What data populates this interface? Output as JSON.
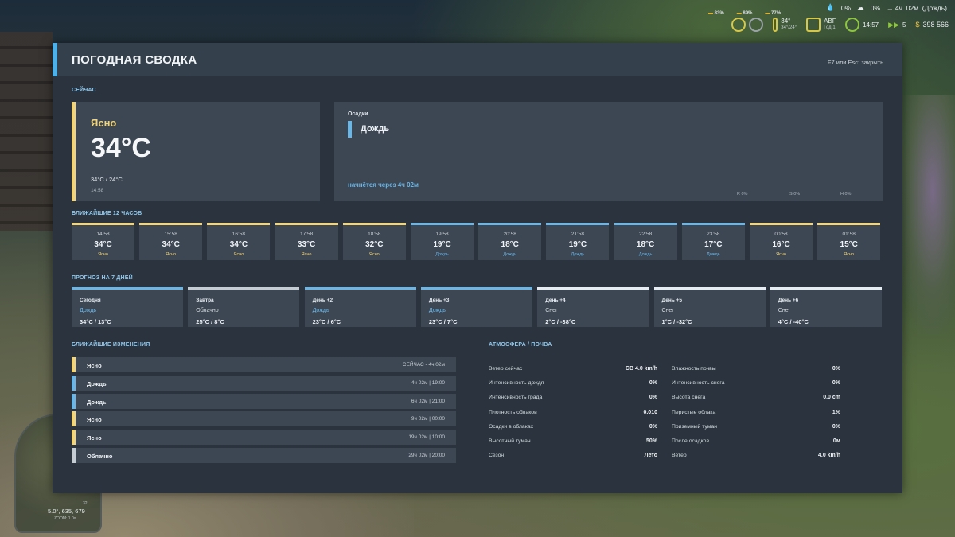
{
  "hud": {
    "stat1": "0%",
    "stat2": "0%",
    "forecast": "→ 4ч. 02м. (Дождь)",
    "mini1": "83%",
    "mini2": "89%",
    "mini3": "77%",
    "temp": "34°",
    "temp_range": "34°/24°",
    "month": "АВГ",
    "year": "Год 1",
    "clock": "14:57",
    "speed": "5",
    "money_symbol": "$",
    "money": "398 566"
  },
  "minimap": {
    "coords": "5.0°, 635, 679",
    "zoom": "ZOOM: 1.0x",
    "north": "32"
  },
  "panel": {
    "title": "ПОГОДНАЯ СВОДКА",
    "hint": "F7 или Esc: закрыть"
  },
  "sections": {
    "now": "СЕЙЧАС",
    "hours": "БЛИЖАЙШИЕ 12 ЧАСОВ",
    "days": "ПРОГНОЗ НА 7 ДНЕЙ",
    "changes": "БЛИЖАЙШИЕ ИЗМЕНЕНИЯ",
    "atmosphere": "АТМОСФЕРА / ПОЧВА"
  },
  "now": {
    "condition": "Ясно",
    "temp": "34°C",
    "range": "34°C  /  24°C",
    "time": "14:58"
  },
  "precip": {
    "label": "Осадки",
    "value": "Дождь",
    "starts": "начнётся через  4ч 02м",
    "r": "R 0%",
    "s": "S 0%",
    "h": "H 0%"
  },
  "hours": [
    {
      "time": "14:58",
      "temp": "34°C",
      "cond": "Ясно",
      "kind": "sun"
    },
    {
      "time": "15:58",
      "temp": "34°C",
      "cond": "Ясно",
      "kind": "sun"
    },
    {
      "time": "16:58",
      "temp": "34°C",
      "cond": "Ясно",
      "kind": "sun"
    },
    {
      "time": "17:58",
      "temp": "33°C",
      "cond": "Ясно",
      "kind": "sun"
    },
    {
      "time": "18:58",
      "temp": "32°C",
      "cond": "Ясно",
      "kind": "sun"
    },
    {
      "time": "19:58",
      "temp": "19°C",
      "cond": "Дождь",
      "kind": "rain"
    },
    {
      "time": "20:58",
      "temp": "18°C",
      "cond": "Дождь",
      "kind": "rain"
    },
    {
      "time": "21:58",
      "temp": "19°C",
      "cond": "Дождь",
      "kind": "rain"
    },
    {
      "time": "22:58",
      "temp": "18°C",
      "cond": "Дождь",
      "kind": "rain"
    },
    {
      "time": "23:58",
      "temp": "17°C",
      "cond": "Дождь",
      "kind": "rain"
    },
    {
      "time": "00:58",
      "temp": "16°C",
      "cond": "Ясно",
      "kind": "sun"
    },
    {
      "time": "01:58",
      "temp": "15°C",
      "cond": "Ясно",
      "kind": "sun"
    }
  ],
  "days": [
    {
      "name": "Сегодня",
      "cond": "Дождь",
      "range": "34°C  /  13°C",
      "kind": "rain"
    },
    {
      "name": "Завтра",
      "cond": "Облачно",
      "range": "25°C  /  8°C",
      "kind": "cloud"
    },
    {
      "name": "День +2",
      "cond": "Дождь",
      "range": "23°C  /  6°C",
      "kind": "rain"
    },
    {
      "name": "День +3",
      "cond": "Дождь",
      "range": "23°C  /  7°C",
      "kind": "rain"
    },
    {
      "name": "День +4",
      "cond": "Снег",
      "range": "2°C  /  -38°C",
      "kind": "snow"
    },
    {
      "name": "День +5",
      "cond": "Снег",
      "range": "1°C  /  -32°C",
      "kind": "snow"
    },
    {
      "name": "День +6",
      "cond": "Снег",
      "range": "4°C  /  -40°C",
      "kind": "snow"
    }
  ],
  "changes": [
    {
      "name": "Ясно",
      "time": "СЕЙЧАС  -  4ч 02м",
      "kind": "sun"
    },
    {
      "name": "Дождь",
      "time": "4ч 02м  |  19:00",
      "kind": "rain"
    },
    {
      "name": "Дождь",
      "time": "6ч 02м  |  21:00",
      "kind": "rain"
    },
    {
      "name": "Ясно",
      "time": "9ч 02м  |  00:00",
      "kind": "sun"
    },
    {
      "name": "Ясно",
      "time": "19ч 02м  |  10:00",
      "kind": "sun"
    },
    {
      "name": "Облачно",
      "time": "29ч 02м  |  20:00",
      "kind": "cloud"
    }
  ],
  "atmosphere_left": [
    {
      "label": "Ветер сейчас",
      "value": "СВ  4.0 km/h"
    },
    {
      "label": "Интенсивность дождя",
      "value": "0%"
    },
    {
      "label": "Интенсивность града",
      "value": "0%"
    },
    {
      "label": "Плотность облаков",
      "value": "0.010"
    },
    {
      "label": "Осадки в облаках",
      "value": "0%"
    },
    {
      "label": "Высотный туман",
      "value": "50%"
    },
    {
      "label": "Сезон",
      "value": "Лето"
    }
  ],
  "atmosphere_right": [
    {
      "label": "Влажность почвы",
      "value": "0%"
    },
    {
      "label": "Интенсивность снега",
      "value": "0%"
    },
    {
      "label": "Высота снега",
      "value": "0.0 cm"
    },
    {
      "label": "Перистые облака",
      "value": "1%"
    },
    {
      "label": "Приземный туман",
      "value": "0%"
    },
    {
      "label": "После осадков",
      "value": "0м"
    },
    {
      "label": "Ветер",
      "value": "4.0 km/h"
    }
  ],
  "colors": {
    "sun": "#f2d57a",
    "rain": "#6cb6e6",
    "cloud": "#c5ccd2",
    "snow": "#e6ecf0",
    "accent": "#4fb0e8",
    "panel": "#2a333e",
    "card": "#3d4754"
  }
}
